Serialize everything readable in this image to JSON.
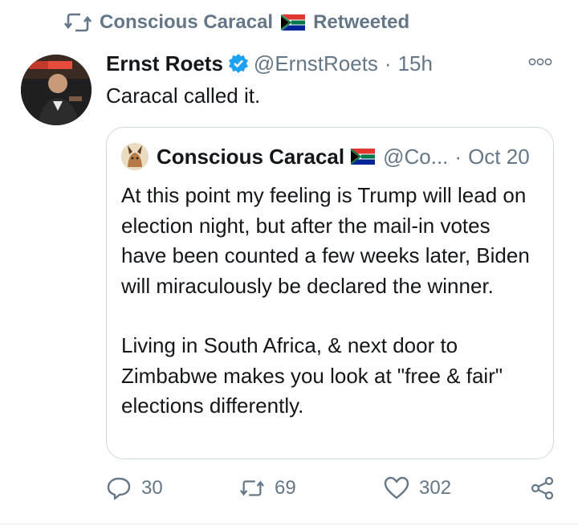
{
  "retweet_header": {
    "retweeter": "Conscious Caracal",
    "label": "Retweeted"
  },
  "tweet": {
    "author_name": "Ernst Roets",
    "handle": "@ErnstRoets",
    "separator": "·",
    "time": "15h",
    "text": "Caracal called it."
  },
  "quoted_tweet": {
    "author_name": "Conscious Caracal",
    "handle": "@Co...",
    "separator": "·",
    "date": "Oct 20",
    "paragraph_1": "At this point my feeling is Trump will lead on election night, but after the mail-in votes have been counted a few weeks later, Biden will miraculously be declared the winner.",
    "paragraph_2": "Living in South Africa, & next door to Zimbabwe makes you look at \"free & fair\" elections differently."
  },
  "actions": {
    "replies": "30",
    "retweets": "69",
    "likes": "302"
  },
  "icons": {
    "retweet": "retweet-icon",
    "verified": "verified-badge-icon",
    "more": "more-options-icon",
    "reply": "reply-icon",
    "like": "heart-icon",
    "share": "share-icon",
    "flag": "south-africa-flag-icon"
  },
  "colors": {
    "muted": "#657786",
    "text": "#14171a",
    "verified": "#1da1f2",
    "border": "#cfd9de"
  }
}
